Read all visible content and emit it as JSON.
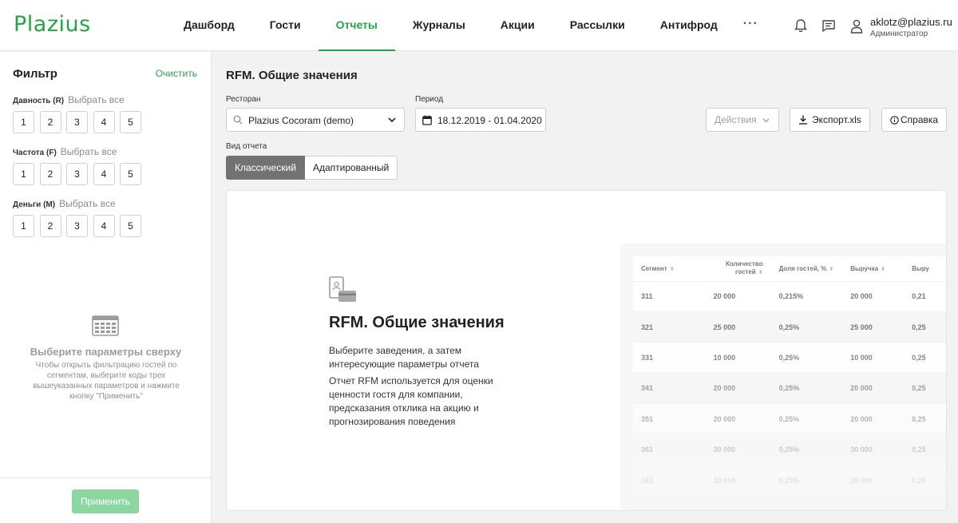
{
  "app": {
    "logo": "Plazius"
  },
  "nav": {
    "items": [
      {
        "label": "Дашборд",
        "active": false
      },
      {
        "label": "Гости",
        "active": false
      },
      {
        "label": "Отчеты",
        "active": true
      },
      {
        "label": "Журналы",
        "active": false
      },
      {
        "label": "Акции",
        "active": false
      },
      {
        "label": "Рассылки",
        "active": false
      },
      {
        "label": "Антифрод",
        "active": false
      }
    ],
    "more": "···"
  },
  "user": {
    "email": "aklotz@plazius.ru",
    "role": "Администратор"
  },
  "filter": {
    "title": "Фильтр",
    "clear": "Очистить",
    "groups": [
      {
        "label": "Давность (R)",
        "select_all": "Выбрать все",
        "values": [
          "1",
          "2",
          "3",
          "4",
          "5"
        ]
      },
      {
        "label": "Частота (F)",
        "select_all": "Выбрать все",
        "values": [
          "1",
          "2",
          "3",
          "4",
          "5"
        ]
      },
      {
        "label": "Деньги (M)",
        "select_all": "Выбрать все",
        "values": [
          "1",
          "2",
          "3",
          "4",
          "5"
        ]
      }
    ],
    "empty_title": "Выберите параметры сверху",
    "empty_text": "Чтобы открыть фильтрацию гостей по сегментам, выберите коды трех вышеуказанных параметров и нажмите кнопку \"Применить\"",
    "apply": "Применить"
  },
  "main": {
    "title": "RFM. Общие значения",
    "restaurant_label": "Ресторан",
    "restaurant_value": "Plazius Cocoram (demo)",
    "period_label": "Период",
    "period_value": "18.12.2019 - 01.04.2020",
    "actions": "Действия",
    "export": "Экспорт.xls",
    "help": "Справка",
    "view_label": "Вид отчета",
    "views": [
      "Классический",
      "Адаптированный"
    ]
  },
  "card": {
    "title": "RFM. Общие значения",
    "p1": "Выберите заведения, а затем интересующие параметры отчета",
    "p2": "Отчет RFM используется для оценки ценности гостя для компании, предсказания отклика на акцию и прогнозирования поведения"
  },
  "preview_table": {
    "headers": [
      "Сегмент",
      "Количество гостей",
      "Доля гостей, %",
      "Выручка",
      "Выру"
    ],
    "rows": [
      [
        "311",
        "20 000",
        "0,215%",
        "20 000",
        "0,21"
      ],
      [
        "321",
        "25 000",
        "0,25%",
        "25 000",
        "0,25"
      ],
      [
        "331",
        "10 000",
        "0,25%",
        "10 000",
        "0,25"
      ],
      [
        "341",
        "20 000",
        "0,25%",
        "20 000",
        "0,25"
      ],
      [
        "351",
        "20 000",
        "0,25%",
        "20 000",
        "0,25"
      ],
      [
        "361",
        "30 000",
        "0,25%",
        "30 000",
        "0,25"
      ],
      [
        "361",
        "30 000",
        "0,25%",
        "30 000",
        "0,25"
      ]
    ]
  },
  "colors": {
    "accent": "#27a34a",
    "apply_disabled": "#8bd6a1",
    "segment_active": "#727272"
  }
}
